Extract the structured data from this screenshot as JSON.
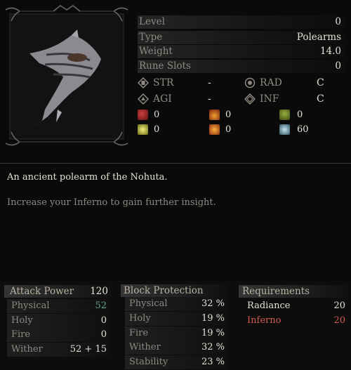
{
  "stats": [
    {
      "label": "Level",
      "value": "0"
    },
    {
      "label": "Type",
      "value": "Polearms"
    },
    {
      "label": "Weight",
      "value": "14.0"
    },
    {
      "label": "Rune Slots",
      "value": "0"
    }
  ],
  "attributes": [
    {
      "label": "STR",
      "value": "-",
      "icon": "str-icon"
    },
    {
      "label": "RAD",
      "value": "C",
      "icon": "rad-icon"
    },
    {
      "label": "AGI",
      "value": "-",
      "icon": "agi-icon"
    },
    {
      "label": "INF",
      "value": "C",
      "icon": "inf-icon"
    }
  ],
  "elements": {
    "row1": [
      "0",
      "0",
      "0"
    ],
    "row2": [
      "0",
      "0",
      "60"
    ]
  },
  "description": {
    "line1": "An ancient polearm of the Nohuta.",
    "line2": "Increase your Inferno to gain further insight."
  },
  "attack": {
    "title": "Attack Power",
    "total": "120",
    "rows": [
      {
        "label": "Physical",
        "value": "52"
      },
      {
        "label": "Holy",
        "value": "0"
      },
      {
        "label": "Fire",
        "value": "0"
      },
      {
        "label": "Wither",
        "value": "52 + 15"
      }
    ]
  },
  "block": {
    "title": "Block Protection",
    "rows": [
      {
        "label": "Physical",
        "value": "32 %"
      },
      {
        "label": "Holy",
        "value": "19 %"
      },
      {
        "label": "Fire",
        "value": "19 %"
      },
      {
        "label": "Wither",
        "value": "32 %"
      },
      {
        "label": "Stability",
        "value": "23 %"
      }
    ]
  },
  "requirements": {
    "title": "Requirements",
    "rows": [
      {
        "label": "Radiance",
        "value": "20"
      },
      {
        "label": "Inferno",
        "value": "20"
      }
    ]
  },
  "colors": {
    "accent_green": "#5aa88e",
    "warn_red": "#d45a50"
  }
}
